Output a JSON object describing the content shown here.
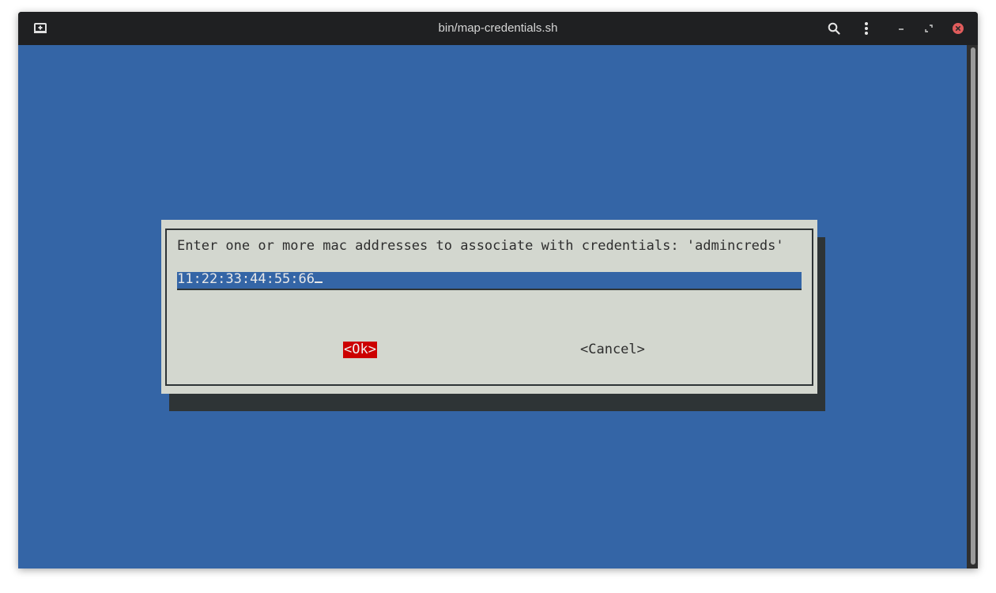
{
  "window": {
    "title": "bin/map-credentials.sh"
  },
  "titlebar": {
    "icons": [
      "new-tab-icon",
      "search-icon",
      "menu-dots-icon",
      "minimize-icon",
      "restore-icon",
      "close-icon"
    ]
  },
  "dialog": {
    "prompt": "Enter one or more mac addresses to associate with credentials: 'admincreds'",
    "input_value": "11:22:33:44:55:66",
    "ok_label": "<Ok>",
    "cancel_label": "<Cancel>"
  },
  "colors": {
    "terminal_bg": "#3465a6",
    "dialog_bg": "#d3d7cf",
    "dialog_shadow": "#2e3436",
    "ok_highlight": "#cc0000",
    "titlebar_bg": "#1f2022",
    "close_button": "#e05c5c"
  }
}
